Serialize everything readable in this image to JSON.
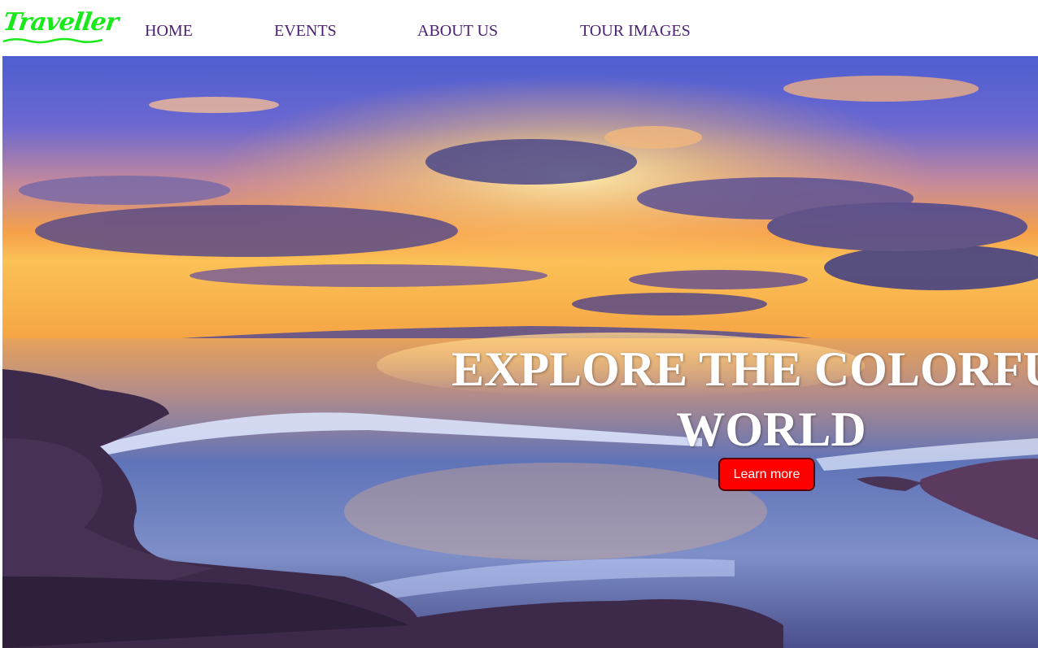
{
  "brand": {
    "logo_text": "Traveller",
    "logo_color": "#19e81a"
  },
  "nav": {
    "items": [
      {
        "label": "HOME"
      },
      {
        "label": "EVENTS"
      },
      {
        "label": "ABOUT US"
      },
      {
        "label": "TOUR IMAGES"
      }
    ],
    "link_color": "#4b2173"
  },
  "hero": {
    "image_name": "sunset-sea-rocks",
    "headline_line1": "EXPLORE THE COLORFUL",
    "headline_line2": "WORLD",
    "cta_label": "Learn more",
    "cta_color": "#ff0000"
  }
}
